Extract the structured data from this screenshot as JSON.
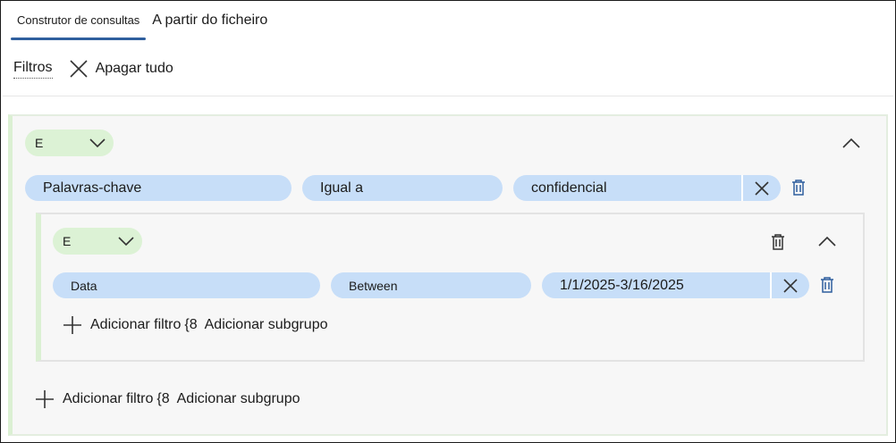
{
  "tabs": [
    {
      "label": "Construtor de consultas",
      "active": true
    },
    {
      "label": "A partir do ficheiro",
      "active": false
    }
  ],
  "toolbar": {
    "filters_label": "Filtros",
    "clear_all_label": "Apagar tudo"
  },
  "outer_group": {
    "operator": "E",
    "condition": {
      "field": "Palavras-chave",
      "comparison": "Igual a",
      "value": "confidencial"
    },
    "add_filter_label": "Adicionar filtro",
    "add_subgroup_glyph": "{8",
    "add_subgroup_label": "Adicionar subgrupo"
  },
  "inner_group": {
    "operator": "E",
    "condition": {
      "field": "Data",
      "comparison": "Between",
      "value": "1/1/2025-3/16/2025"
    },
    "add_filter_label": "Adicionar filtro",
    "add_subgroup_glyph": "{8",
    "add_subgroup_label": "Adicionar subgrupo"
  },
  "colors": {
    "tab_underline": "#2f5f9e",
    "pill_blue": "#c7def8",
    "operator_green": "#dcf2d5",
    "group_border_green": "#dbf0d3",
    "trash_blue": "#2f5f9e"
  }
}
